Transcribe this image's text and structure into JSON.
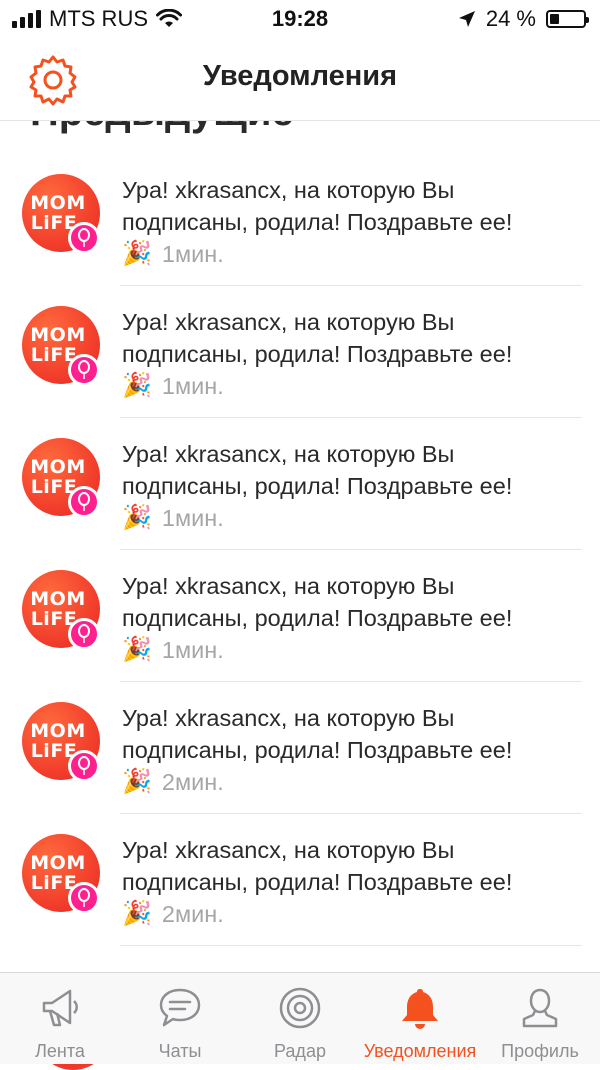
{
  "status_bar": {
    "carrier": "MTS RUS",
    "time": "19:28",
    "battery_text": "24 %",
    "battery_level_percent": 24
  },
  "header": {
    "title": "Уведомления",
    "settings_icon": "gear-icon"
  },
  "section": {
    "title": "Предыдущие"
  },
  "avatar": {
    "line1": "MOM",
    "line2": "LiFE",
    "badge_icon": "balloon-icon"
  },
  "notifications": [
    {
      "text": "Ура! xkrasancx, на которую Вы подписаны, родила! Поздравьте ее!",
      "emoji": "🎉",
      "time": "1мин."
    },
    {
      "text": "Ура! xkrasancx, на которую Вы подписаны, родила! Поздравьте ее!",
      "emoji": "🎉",
      "time": "1мин."
    },
    {
      "text": "Ура! xkrasancx, на которую Вы подписаны, родила! Поздравьте ее!",
      "emoji": "🎉",
      "time": "1мин."
    },
    {
      "text": "Ура! xkrasancx, на которую Вы подписаны, родила! Поздравьте ее!",
      "emoji": "🎉",
      "time": "1мин."
    },
    {
      "text": "Ура! xkrasancx, на которую Вы подписаны, родила! Поздравьте ее!",
      "emoji": "🎉",
      "time": "2мин."
    },
    {
      "text": "Ура! xkrasancx, на которую Вы подписаны, родила! Поздравьте ее!",
      "emoji": "🎉",
      "time": "2мин."
    }
  ],
  "tabs": [
    {
      "label": "Лента",
      "icon": "megaphone-icon"
    },
    {
      "label": "Чаты",
      "icon": "chat-bubble-icon"
    },
    {
      "label": "Радар",
      "icon": "radar-icon"
    },
    {
      "label": "Уведомления",
      "icon": "bell-icon",
      "active": true
    },
    {
      "label": "Профиль",
      "icon": "person-icon"
    }
  ],
  "colors": {
    "accent": "#f4511e",
    "avatar_red": "#f0392a",
    "badge_pink": "#ff1f8f",
    "muted": "#a6a6a6"
  }
}
